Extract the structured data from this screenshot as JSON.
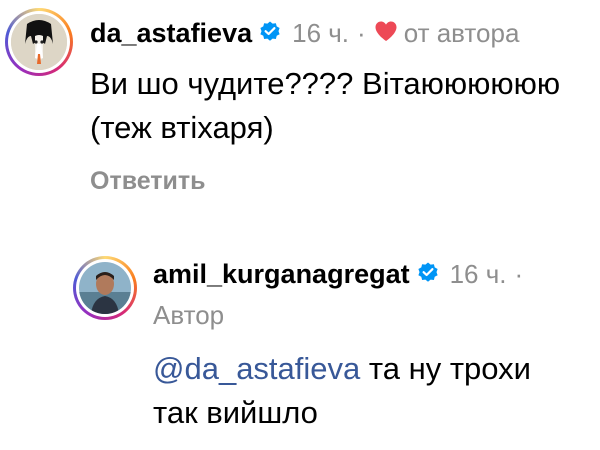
{
  "comment1": {
    "username": "da_astafieva",
    "time": "16 ч.",
    "separator": "·",
    "author_like_label": "от автора",
    "text": "Ви шо чудите???? Вітаюююююю (теж втіхаря)",
    "text_line1": "Ви шо чудите???? Вітаюююююю",
    "text_line2": "(теж втіхаря)",
    "reply_label": "Ответить"
  },
  "comment2": {
    "username": "amil_kurganagregat",
    "time": "16 ч.",
    "separator": "·",
    "author_badge": "Автор",
    "mention": "@da_astafieva",
    "text_rest": " та ну трохи",
    "text_line2": "так вийшло"
  },
  "colors": {
    "verified": "#0095f6",
    "heart": "#ed4956",
    "mention": "#385898",
    "meta": "#8e8e8e"
  },
  "icons": {
    "verified": "verified-badge-icon",
    "heart": "heart-icon"
  }
}
